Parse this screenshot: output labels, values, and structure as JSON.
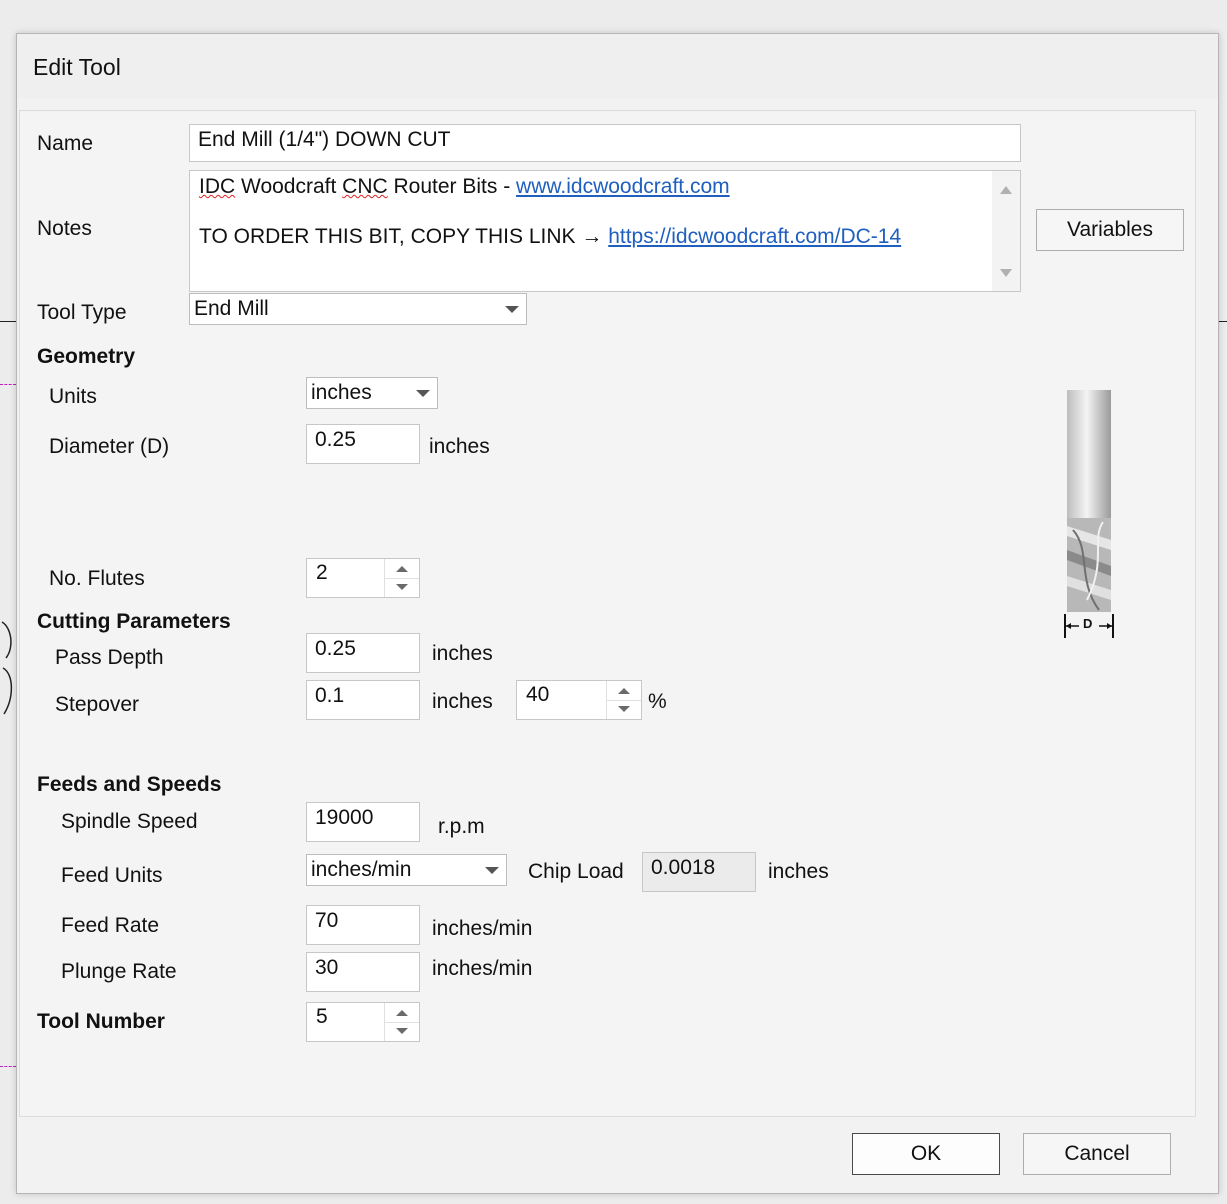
{
  "dialog": {
    "title": "Edit Tool"
  },
  "name": {
    "label": "Name",
    "value": "End Mill (1/4\") DOWN CUT"
  },
  "notes": {
    "label": "Notes",
    "line1_prefix": "IDC",
    "line1_mid1": " Woodcraft ",
    "line1_cnc": "CNC",
    "line1_mid2": " Router Bits - ",
    "line1_link": "www.idcwoodcraft.com",
    "line2_prefix": "TO ORDER THIS BIT, COPY THIS LINK → ",
    "line2_link": "https://idcwoodcraft.com/DC-14"
  },
  "variables_button": "Variables",
  "tool_type": {
    "label": "Tool Type",
    "value": "End Mill"
  },
  "geometry": {
    "heading": "Geometry",
    "units_label": "Units",
    "units_value": "inches",
    "diameter_label": "Diameter (D)",
    "diameter_value": "0.25",
    "diameter_unit": "inches",
    "flutes_label": "No. Flutes",
    "flutes_value": "2",
    "diagram_label": "D"
  },
  "cutting": {
    "heading": "Cutting Parameters",
    "pass_depth_label": "Pass Depth",
    "pass_depth_value": "0.25",
    "pass_depth_unit": "inches",
    "stepover_label": "Stepover",
    "stepover_value": "0.1",
    "stepover_unit": "inches",
    "stepover_percent": "40",
    "percent_sign": "%"
  },
  "feeds": {
    "heading": "Feeds and Speeds",
    "spindle_label": "Spindle Speed",
    "spindle_value": "19000",
    "spindle_unit": "r.p.m",
    "feed_units_label": "Feed Units",
    "feed_units_value": "inches/min",
    "chip_load_label": "Chip Load",
    "chip_load_value": "0.0018",
    "chip_load_unit": "inches",
    "feed_rate_label": "Feed Rate",
    "feed_rate_value": "70",
    "feed_rate_unit": "inches/min",
    "plunge_label": "Plunge Rate",
    "plunge_value": "30",
    "plunge_unit": "inches/min"
  },
  "tool_number": {
    "label": "Tool Number",
    "value": "5"
  },
  "buttons": {
    "ok": "OK",
    "cancel": "Cancel"
  },
  "colors": {
    "link": "#1f5fbf",
    "background": "#f2f2f2"
  }
}
